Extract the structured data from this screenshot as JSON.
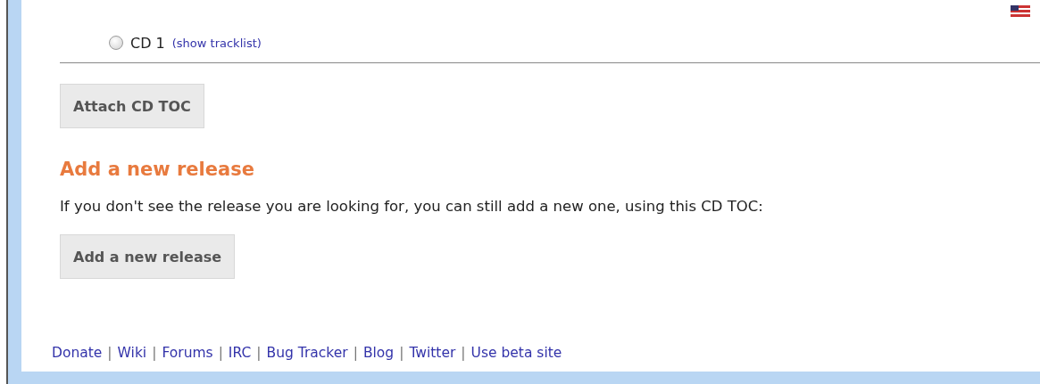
{
  "disc": {
    "selected": false,
    "label": "CD 1",
    "link": "(show tracklist)"
  },
  "attach_button": "Attach CD TOC",
  "new_release": {
    "heading": "Add a new release",
    "text": "If you don't see the release you are looking for, you can still add a new one, using this CD TOC:",
    "button": "Add a new release"
  },
  "footer": [
    {
      "kind": "link",
      "text": "Donate"
    },
    {
      "kind": "sep",
      "text": "|"
    },
    {
      "kind": "link",
      "text": "Wiki"
    },
    {
      "kind": "sep",
      "text": "|"
    },
    {
      "kind": "link",
      "text": "Forums"
    },
    {
      "kind": "sep",
      "text": "|"
    },
    {
      "kind": "link",
      "text": "IRC"
    },
    {
      "kind": "sep",
      "text": "|"
    },
    {
      "kind": "link",
      "text": "Bug Tracker"
    },
    {
      "kind": "sep",
      "text": "|"
    },
    {
      "kind": "link",
      "text": "Blog"
    },
    {
      "kind": "sep",
      "text": "|"
    },
    {
      "kind": "link",
      "text": "Twitter"
    },
    {
      "kind": "sep",
      "text": "|"
    },
    {
      "kind": "link",
      "text": "Use beta site"
    }
  ]
}
